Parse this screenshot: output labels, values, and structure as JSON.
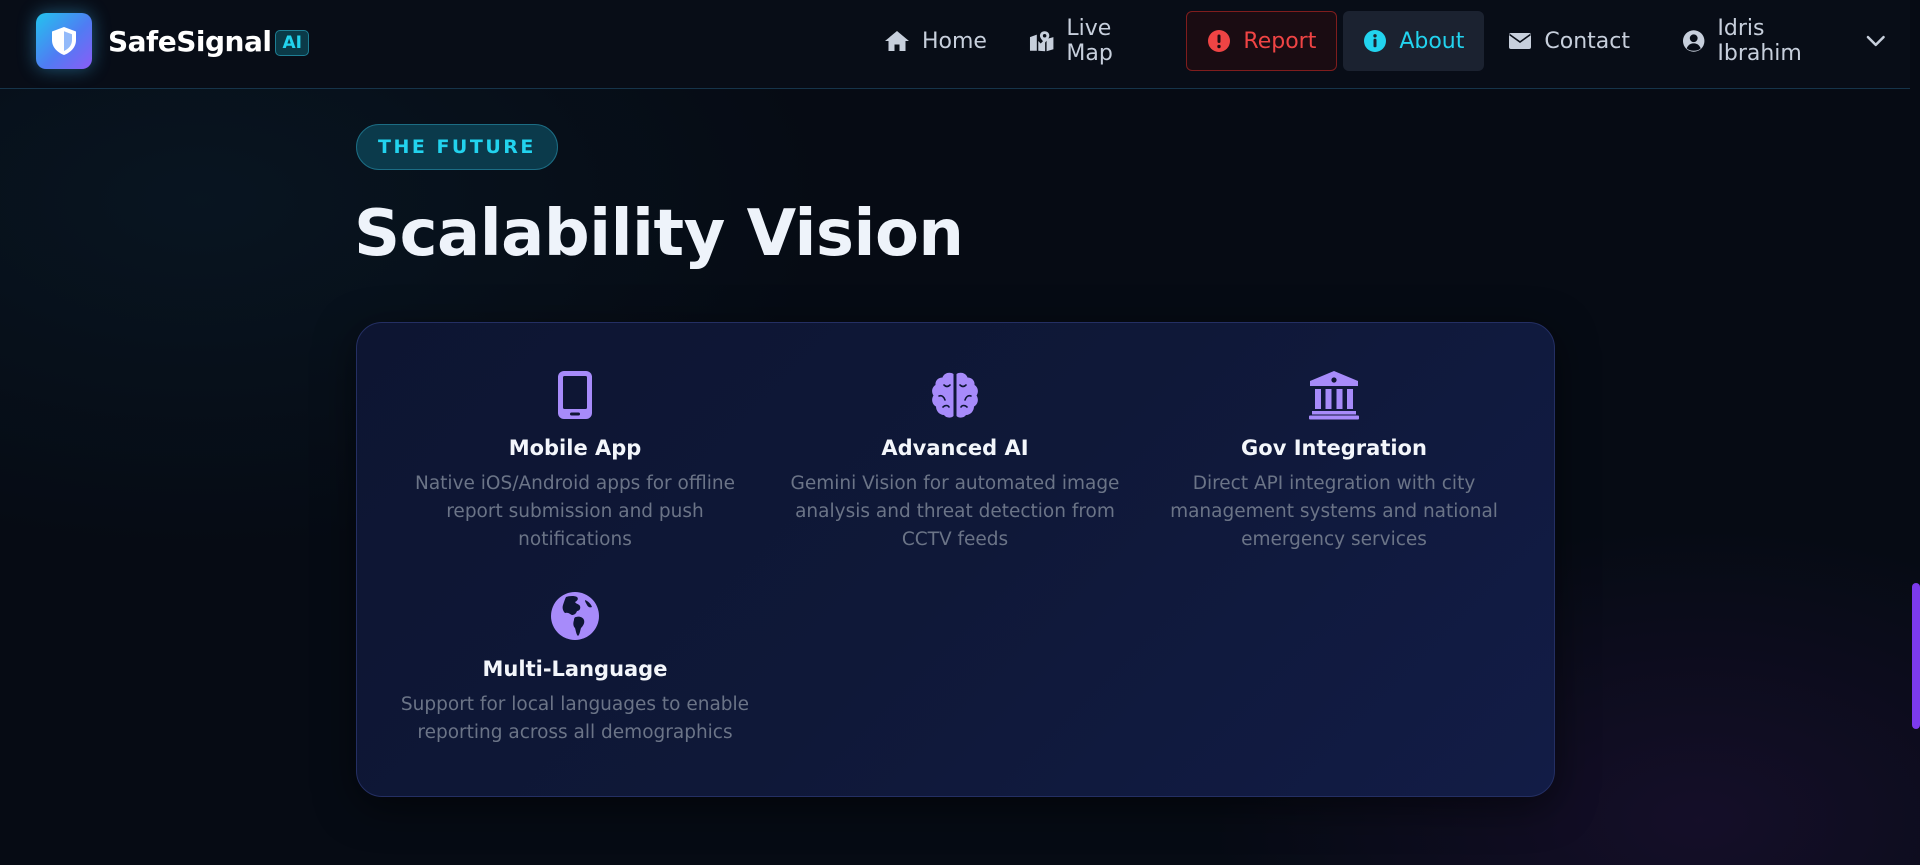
{
  "brand": {
    "name": "SafeSignal",
    "badge": "AI"
  },
  "nav": {
    "home": "Home",
    "live_map": "Live Map",
    "report": "Report",
    "about": "About",
    "contact": "Contact",
    "user": "Idris Ibrahim"
  },
  "section": {
    "tag": "THE FUTURE",
    "title": "Scalability Vision"
  },
  "features": [
    {
      "icon": "mobile-icon",
      "title": "Mobile App",
      "description": "Native iOS/Android apps for offline report submission and push notifications"
    },
    {
      "icon": "brain-icon",
      "title": "Advanced AI",
      "description": "Gemini Vision for automated image analysis and threat detection from CCTV feeds"
    },
    {
      "icon": "landmark-icon",
      "title": "Gov Integration",
      "description": "Direct API integration with city management systems and national emergency services"
    },
    {
      "icon": "globe-icon",
      "title": "Multi-Language",
      "description": "Support for local languages to enable reporting across all demographics"
    }
  ],
  "colors": {
    "accent_cyan": "#22d3ee",
    "accent_purple": "#a78bfa",
    "danger": "#ef4444",
    "background": "#060b14"
  }
}
